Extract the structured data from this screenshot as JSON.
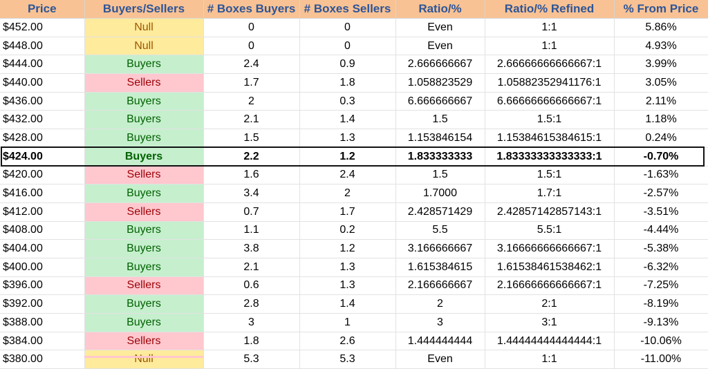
{
  "headers": [
    "Price",
    "Buyers/Sellers",
    "# Boxes Buyers",
    "# Boxes Sellers",
    "Ratio/%",
    "Ratio/% Refined",
    "% From Price"
  ],
  "rows": [
    {
      "price": "$452.00",
      "bs": "Null",
      "buy": "0",
      "sell": "0",
      "ratio": "Even",
      "refined": "1:1",
      "pct": "5.86%"
    },
    {
      "price": "$448.00",
      "bs": "Null",
      "buy": "0",
      "sell": "0",
      "ratio": "Even",
      "refined": "1:1",
      "pct": "4.93%"
    },
    {
      "price": "$444.00",
      "bs": "Buyers",
      "buy": "2.4",
      "sell": "0.9",
      "ratio": "2.666666667",
      "refined": "2.66666666666667:1",
      "pct": "3.99%"
    },
    {
      "price": "$440.00",
      "bs": "Sellers",
      "buy": "1.7",
      "sell": "1.8",
      "ratio": "1.058823529",
      "refined": "1.05882352941176:1",
      "pct": "3.05%"
    },
    {
      "price": "$436.00",
      "bs": "Buyers",
      "buy": "2",
      "sell": "0.3",
      "ratio": "6.666666667",
      "refined": "6.66666666666667:1",
      "pct": "2.11%"
    },
    {
      "price": "$432.00",
      "bs": "Buyers",
      "buy": "2.1",
      "sell": "1.4",
      "ratio": "1.5",
      "refined": "1.5:1",
      "pct": "1.18%"
    },
    {
      "price": "$428.00",
      "bs": "Buyers",
      "buy": "1.5",
      "sell": "1.3",
      "ratio": "1.153846154",
      "refined": "1.15384615384615:1",
      "pct": "0.24%"
    },
    {
      "price": "$424.00",
      "bs": "Buyers",
      "buy": "2.2",
      "sell": "1.2",
      "ratio": "1.833333333",
      "refined": "1.83333333333333:1",
      "pct": "-0.70%",
      "current": true
    },
    {
      "price": "$420.00",
      "bs": "Sellers",
      "buy": "1.6",
      "sell": "2.4",
      "ratio": "1.5",
      "refined": "1.5:1",
      "pct": "-1.63%"
    },
    {
      "price": "$416.00",
      "bs": "Buyers",
      "buy": "3.4",
      "sell": "2",
      "ratio": "1.7000",
      "refined": "1.7:1",
      "pct": "-2.57%"
    },
    {
      "price": "$412.00",
      "bs": "Sellers",
      "buy": "0.7",
      "sell": "1.7",
      "ratio": "2.428571429",
      "refined": "2.42857142857143:1",
      "pct": "-3.51%"
    },
    {
      "price": "$408.00",
      "bs": "Buyers",
      "buy": "1.1",
      "sell": "0.2",
      "ratio": "5.5",
      "refined": "5.5:1",
      "pct": "-4.44%"
    },
    {
      "price": "$404.00",
      "bs": "Buyers",
      "buy": "3.8",
      "sell": "1.2",
      "ratio": "3.166666667",
      "refined": "3.16666666666667:1",
      "pct": "-5.38%"
    },
    {
      "price": "$400.00",
      "bs": "Buyers",
      "buy": "2.1",
      "sell": "1.3",
      "ratio": "1.615384615",
      "refined": "1.61538461538462:1",
      "pct": "-6.32%"
    },
    {
      "price": "$396.00",
      "bs": "Sellers",
      "buy": "0.6",
      "sell": "1.3",
      "ratio": "2.166666667",
      "refined": "2.16666666666667:1",
      "pct": "-7.25%"
    },
    {
      "price": "$392.00",
      "bs": "Buyers",
      "buy": "2.8",
      "sell": "1.4",
      "ratio": "2",
      "refined": "2:1",
      "pct": "-8.19%"
    },
    {
      "price": "$388.00",
      "bs": "Buyers",
      "buy": "3",
      "sell": "1",
      "ratio": "3",
      "refined": "3:1",
      "pct": "-9.13%"
    },
    {
      "price": "$384.00",
      "bs": "Sellers",
      "buy": "1.8",
      "sell": "2.6",
      "ratio": "1.444444444",
      "refined": "1.44444444444444:1",
      "pct": "-10.06%"
    },
    {
      "price": "$380.00",
      "bs": "Null",
      "buy": "5.3",
      "sell": "5.3",
      "ratio": "Even",
      "refined": "1:1",
      "pct": "-11.00%"
    }
  ],
  "colors": {
    "header_bg": "#f8c294",
    "header_text": "#2e5597",
    "buyers_bg": "#c6efce",
    "buyers_text": "#006100",
    "sellers_bg": "#ffc7ce",
    "sellers_text": "#9c0006",
    "null_bg": "#ffeb9c",
    "null_text": "#9c5700"
  }
}
